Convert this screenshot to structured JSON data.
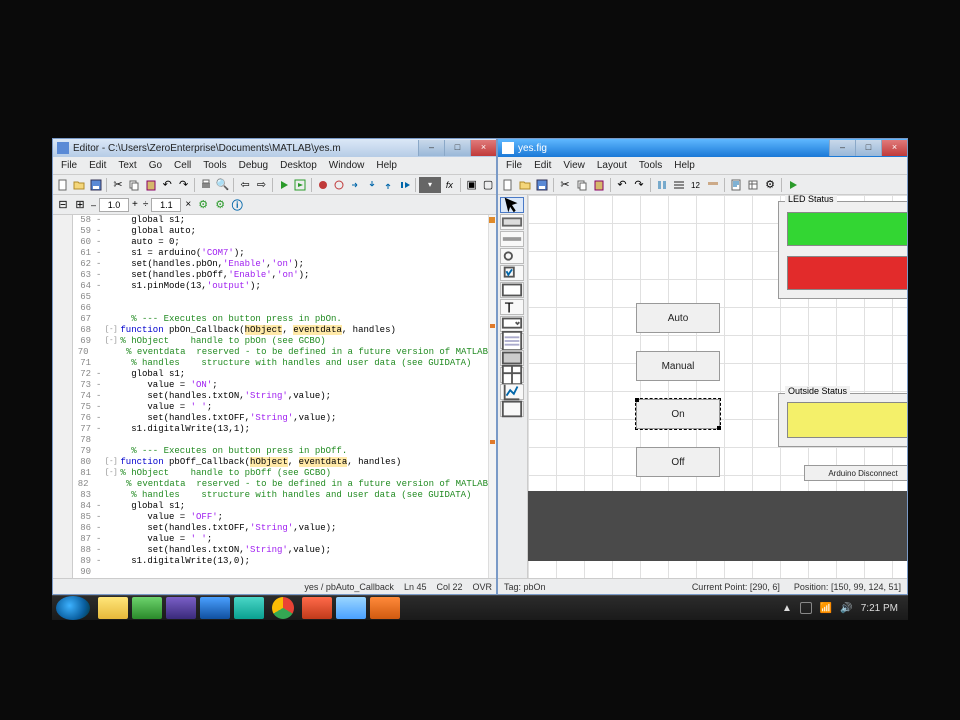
{
  "editor": {
    "title": "Editor - C:\\Users\\ZeroEnterprise\\Documents\\MATLAB\\yes.m",
    "menu": [
      "File",
      "Edit",
      "Text",
      "Go",
      "Cell",
      "Tools",
      "Debug",
      "Desktop",
      "Window",
      "Help"
    ],
    "zoom": {
      "a": "1.0",
      "b": "1.1"
    },
    "code": [
      {
        "n": "58",
        "d": "-",
        "t": "   global s1;"
      },
      {
        "n": "59",
        "d": "-",
        "t": "   global auto;"
      },
      {
        "n": "60",
        "d": "-",
        "t": "   auto = 0;"
      },
      {
        "n": "61",
        "d": "-",
        "t": "   s1 = arduino('COM7');",
        "fr": [
          [
            "'COM7'",
            "str"
          ]
        ]
      },
      {
        "n": "62",
        "d": "-",
        "t": "   set(handles.pbOn,'Enable','on');",
        "fr": [
          [
            "'Enable'",
            "str"
          ],
          [
            "'on'",
            "str"
          ]
        ]
      },
      {
        "n": "63",
        "d": "-",
        "t": "   set(handles.pbOff,'Enable','on');",
        "fr": [
          [
            "'Enable'",
            "str"
          ],
          [
            "'on'",
            "str"
          ]
        ]
      },
      {
        "n": "64",
        "d": "-",
        "t": "   s1.pinMode(13,'output');",
        "fr": [
          [
            "'output'",
            "str"
          ]
        ]
      },
      {
        "n": "65",
        "d": " ",
        "t": ""
      },
      {
        "n": "66",
        "d": " ",
        "t": ""
      },
      {
        "n": "67",
        "d": " ",
        "t": "   % --- Executes on button press in pbOn.",
        "cls": "cmt"
      },
      {
        "n": "68",
        "d": " ",
        "f": "-",
        "t": " function pbOn_Callback(hObject, eventdata, handles)",
        "kw": "function",
        "hl": [
          "hObject",
          "eventdata"
        ]
      },
      {
        "n": "69",
        "d": " ",
        "f": "-",
        "t": " % hObject    handle to pbOn (see GCBO)",
        "cls": "cmt"
      },
      {
        "n": "70",
        "d": " ",
        "t": "   % eventdata  reserved - to be defined in a future version of MATLAB",
        "cls": "cmt"
      },
      {
        "n": "71",
        "d": " ",
        "t": "   % handles    structure with handles and user data (see GUIDATA)",
        "cls": "cmt"
      },
      {
        "n": "72",
        "d": "-",
        "t": "   global s1;"
      },
      {
        "n": "73",
        "d": "-",
        "t": "      value = 'ON';",
        "fr": [
          [
            "'ON'",
            "str"
          ]
        ]
      },
      {
        "n": "74",
        "d": "-",
        "t": "      set(handles.txtON,'String',value);",
        "fr": [
          [
            "'String'",
            "str"
          ]
        ]
      },
      {
        "n": "75",
        "d": "-",
        "t": "      value = ' ';",
        "fr": [
          [
            "' '",
            "str"
          ]
        ]
      },
      {
        "n": "76",
        "d": "-",
        "t": "      set(handles.txtOFF,'String',value);",
        "fr": [
          [
            "'String'",
            "str"
          ]
        ]
      },
      {
        "n": "77",
        "d": "-",
        "t": "   s1.digitalWrite(13,1);"
      },
      {
        "n": "78",
        "d": " ",
        "t": ""
      },
      {
        "n": "79",
        "d": " ",
        "t": "   % --- Executes on button press in pbOff.",
        "cls": "cmt"
      },
      {
        "n": "80",
        "d": " ",
        "f": "-",
        "t": " function pbOff_Callback(hObject, eventdata, handles)",
        "kw": "function",
        "hl": [
          "hObject",
          "eventdata"
        ]
      },
      {
        "n": "81",
        "d": " ",
        "f": "-",
        "t": " % hObject    handle to pbOff (see GCBO)",
        "cls": "cmt"
      },
      {
        "n": "82",
        "d": " ",
        "t": "   % eventdata  reserved - to be defined in a future version of MATLAB",
        "cls": "cmt"
      },
      {
        "n": "83",
        "d": " ",
        "t": "   % handles    structure with handles and user data (see GUIDATA)",
        "cls": "cmt"
      },
      {
        "n": "84",
        "d": "-",
        "t": "   global s1;"
      },
      {
        "n": "85",
        "d": "-",
        "t": "      value = 'OFF';",
        "fr": [
          [
            "'OFF'",
            "str"
          ]
        ]
      },
      {
        "n": "86",
        "d": "-",
        "t": "      set(handles.txtOFF,'String',value);",
        "fr": [
          [
            "'String'",
            "str"
          ]
        ]
      },
      {
        "n": "87",
        "d": "-",
        "t": "      value = ' ';",
        "fr": [
          [
            "' '",
            "str"
          ]
        ]
      },
      {
        "n": "88",
        "d": "-",
        "t": "      set(handles.txtON,'String',value);",
        "fr": [
          [
            "'String'",
            "str"
          ]
        ]
      },
      {
        "n": "89",
        "d": "-",
        "t": "   s1.digitalWrite(13,0);"
      },
      {
        "n": "90",
        "d": " ",
        "t": ""
      }
    ],
    "status": {
      "fn": "yes / pbAuto_Callback",
      "ln": "Ln  45",
      "col": "Col  22",
      "ovr": "OVR"
    }
  },
  "guide": {
    "title": "yes.fig",
    "menu": [
      "File",
      "Edit",
      "View",
      "Layout",
      "Tools",
      "Help"
    ],
    "buttons": {
      "auto": "Auto",
      "manual": "Manual",
      "on": "On",
      "off": "Off",
      "disc": "Arduino Disconnect"
    },
    "panels": {
      "led": "LED Status",
      "out": "Outside Status"
    },
    "colors": {
      "green": "#33d633",
      "red": "#e22b2b",
      "yellow": "#f4f06a"
    },
    "status": {
      "tag_l": "Tag:",
      "tag_v": "pbOn",
      "cp_l": "Current Point:",
      "cp_v": "[290, 6]",
      "pos_l": "Position:",
      "pos_v": "[150, 99, 124, 51]"
    }
  },
  "taskbar": {
    "clock": "7:21 PM"
  }
}
